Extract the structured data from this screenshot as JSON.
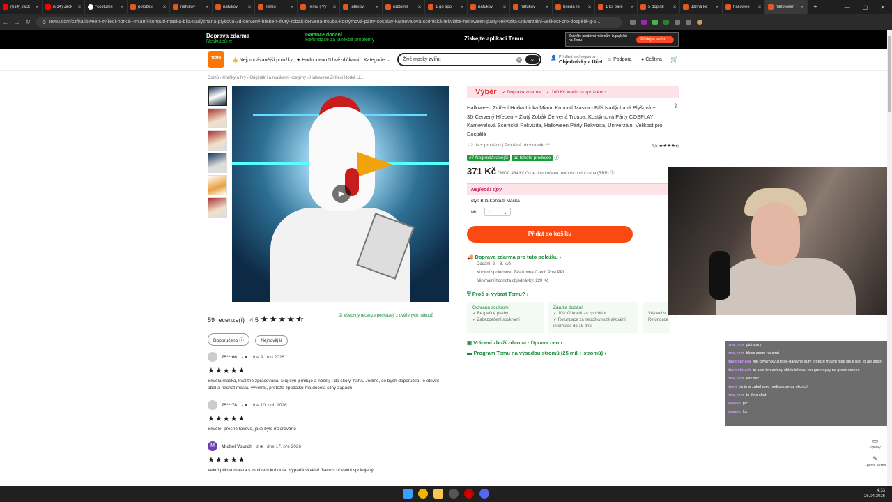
{
  "tabs": [
    {
      "label": "(614) Jack",
      "type": "yt"
    },
    {
      "label": "(614) Jack",
      "type": "yt"
    },
    {
      "label": "\"costume",
      "type": "gg"
    },
    {
      "label": "položku",
      "type": "temu"
    },
    {
      "label": "nafukov",
      "type": "temu"
    },
    {
      "label": "nafukov",
      "type": "temu"
    },
    {
      "label": "Temu",
      "type": "temu"
    },
    {
      "label": "Temu | Vy",
      "type": "temu"
    },
    {
      "label": "latexoví",
      "type": "temu"
    },
    {
      "label": "roztomil",
      "type": "temu"
    },
    {
      "label": "1 go spo",
      "type": "temu"
    },
    {
      "label": "nafukov",
      "type": "temu"
    },
    {
      "label": "nafukov",
      "type": "temu"
    },
    {
      "label": "hnědá ro",
      "type": "temu"
    },
    {
      "label": "1 ks baré",
      "type": "temu"
    },
    {
      "label": "5 doplňk",
      "type": "temu"
    },
    {
      "label": "3dílná ka",
      "type": "temu"
    },
    {
      "label": "hallowee",
      "type": "temu"
    },
    {
      "label": "halloween",
      "type": "temu",
      "active": true
    }
  ],
  "url": "temu.com/cz/halloween-zvířecí-horká---miami-kohoutí-maska-bílá-nadýchaná-plyšová-3d-červený-hřeben-žlutý-zobák-červená-trouba-kostýmová-párty-cosplay-karnevalová-scénická-rekvizita-halloween-párty-rekvizita-univerzální-velikost-pro-dospělé-g-6...",
  "promo": {
    "ship_title": "Doprava zdarma",
    "ship_sub": "Neskutečné",
    "guarantee_title": "Garance dodání",
    "guarantee_sub": "Refundace za jakékoli problémy",
    "app": "Získejte aplikaci Temu",
    "sell_text": "Začněte prodávat milionům kupujících na Temu",
    "sell_btn": "Přidejte se hn..."
  },
  "header": {
    "logo": "TEMU",
    "nav1": "Nejprodávanější položky",
    "nav2": "Hodnoceno 5 hvězdičkami",
    "nav3": "Kategorie",
    "search_value": "Živé masky zvířat",
    "login1": "Přihlásit se / registrov",
    "login2": "Objednávky a Účet",
    "support": "Podpora",
    "lang": "Čeština"
  },
  "breadcrumb": "Domů  ›  Hračky a hry  ›  Originální a maškarní kostýmy  ›  Halloween Zvířecí Horká Li...",
  "reviews": {
    "count": "59 recenze(í)",
    "rating": "4,5",
    "verified": "Všechny recenze pocházejí z ověřených nákupů",
    "filter1": "Doporučeno",
    "filter2": "Nejnovější",
    "items": [
      {
        "user": "75***66",
        "date": "dne 9. úno 2026",
        "text": "Skvělá maska, kvalitně zpracovaná. Můj syn ji miluje a nosil ji i do školy, haha. Jediné, co bych doporučila, je otevřít obal a nechat masku vyvětrat, protože zpočátku má docela silný zápach"
      },
      {
        "user": "75***78",
        "date": "dne 10. dub 2026",
        "text": "Skvělé, přesně takové, jaké bylo inzerováno"
      },
      {
        "user": "Michel Vourch",
        "date": "dne 17. bře 2026",
        "text": "Velmi pěkná maska s motivem kohouta. Vypadá skvěle! Jsem s ní velmi spokojený"
      }
    ]
  },
  "product": {
    "vyber": "Výběr",
    "free_ship": "Doprava zdarma",
    "credit": "100 Kč kredit za zpoždění",
    "title": "Halloween Zvířecí Horká Linka Miami Kohoutí Maska - Bílá Nadýchaná Plyšová + 3D Červený Hřeben + Žlutý Zobák Červená Trouba, Kostýmová Párty COSPLAY Karnevalová Scénická Rekvizita, Halloween Párty Rekvizita, Univerzální Velikost pro Dospělé",
    "sold": "1,2 tis.+ prodáno | Prodává obchodník ***",
    "rating": "4,5",
    "best_badge": "#7 Nejprodávanější",
    "best_text": "od tohoto prodejce",
    "price": "371 Kč",
    "rrp": "DMOC 464 Kč Co je doporučená maloobchodní cena (RRP)",
    "tips": "Nejlepší tipy",
    "style": "styl: Bílá Kohoutí Maska",
    "qty_label": "Mn.",
    "qty_value": "1",
    "add_btn": "Přidat do košíku",
    "ship_title": "Doprava zdarma pro tuto položku",
    "delivery": "Dodání: 2. - 8. kvě",
    "carrier": "Kurýrní společnost:  Zásilkovna  Czech Post  PPL",
    "minimum": "Minimální hodnota objednávky: 220 Kč",
    "why": "Proč si vybrat Temu?",
    "privacy_h": "Ochrana soukromí",
    "privacy_1": "Bezpečné platby",
    "privacy_2": "Zabezpečení soukromí",
    "delivery_h": "Záruka dodání",
    "delivery_1": "100 Kč kredit za zpoždění",
    "delivery_2": "Refundace za nepoškytnuté aktuální informace do 15 dnů",
    "return_1": "Vrácení v...",
    "return_2": "Refundace za",
    "returns": "Vrácení zboží zdarma · Úprava cen",
    "program": "Program Temu na výsadbu stromů (25 mil.+ stromů)"
  },
  "chat": [
    {
      "user": "rma_rom",
      "text": "pici sorry"
    },
    {
      "user": "rma_rom",
      "text": "bless zoom na chat"
    },
    {
      "user": "davidokrizek",
      "text": "me chvam kvuli tobe-barevne auty protoze maam hlad jak k nad to ale zasto"
    },
    {
      "user": "davidokrizek",
      "text": "tu a co ten zeleny oblek takovej ten green guy na green screen"
    },
    {
      "user": "rma_rom",
      "text": "kek dec"
    },
    {
      "user": "Itsme",
      "text": "ta to si zakal pred hodinou ze uz skoncil"
    },
    {
      "user": "rma_rom",
      "text": "to d na chat"
    },
    {
      "user": "ksaane",
      "text": "pic"
    },
    {
      "user": "ksaane",
      "text": "loc"
    }
  ],
  "side": {
    "msg": "Zprávy",
    "feedback": "Zpětná vazba"
  },
  "clock": {
    "time": "4:33",
    "date": "26.04.2026"
  }
}
